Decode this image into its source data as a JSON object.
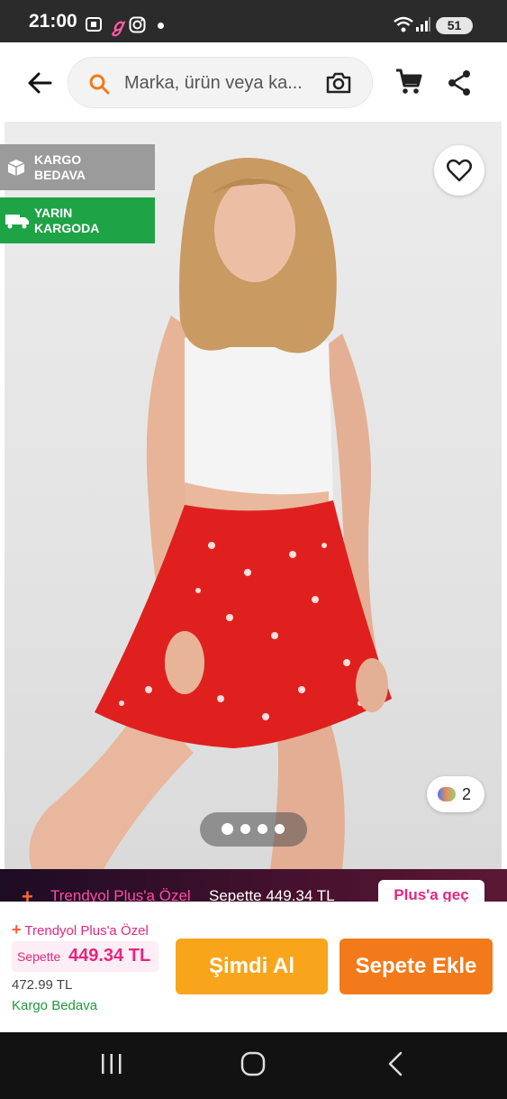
{
  "status_bar": {
    "time": "21:00",
    "battery": "51",
    "icons": [
      "screenshot-icon",
      "app-icon",
      "instagram-icon",
      "dot-icon",
      "wifi-icon",
      "signal-icon"
    ]
  },
  "header": {
    "search_placeholder": "Marka, ürün veya ka...",
    "icons": [
      "back-arrow-icon",
      "search-icon",
      "camera-icon",
      "cart-icon",
      "share-icon"
    ]
  },
  "product_image": {
    "badges": [
      {
        "label": "KARGO BEDAVA",
        "color": "#9b9b9b",
        "icon": "box-icon"
      },
      {
        "label": "YARIN KARGODA",
        "color": "#1fa347",
        "icon": "truck-icon"
      }
    ],
    "color_count": "2",
    "gallery_count": 4,
    "active_index": 0
  },
  "promo_bar": {
    "label": "Trendyol Plus'a Özel",
    "price_text": "Sepette 449.34 TL",
    "button": "Plus'a geç"
  },
  "purchase": {
    "plus_label": "Trendyol Plus'a Özel",
    "cart_label": "Sepette",
    "cart_price": "449.34 TL",
    "old_price": "472.99 TL",
    "shipping": "Kargo Bedava",
    "buy_now": "Şimdi Al",
    "add_to_cart": "Sepete Ekle",
    "colors": {
      "buy_now": "#f8a51c",
      "add_to_cart": "#f27a1a",
      "accent": "#e5267f"
    }
  },
  "nav_bar": {
    "icons": [
      "recent-apps-icon",
      "home-icon",
      "back-icon"
    ]
  }
}
